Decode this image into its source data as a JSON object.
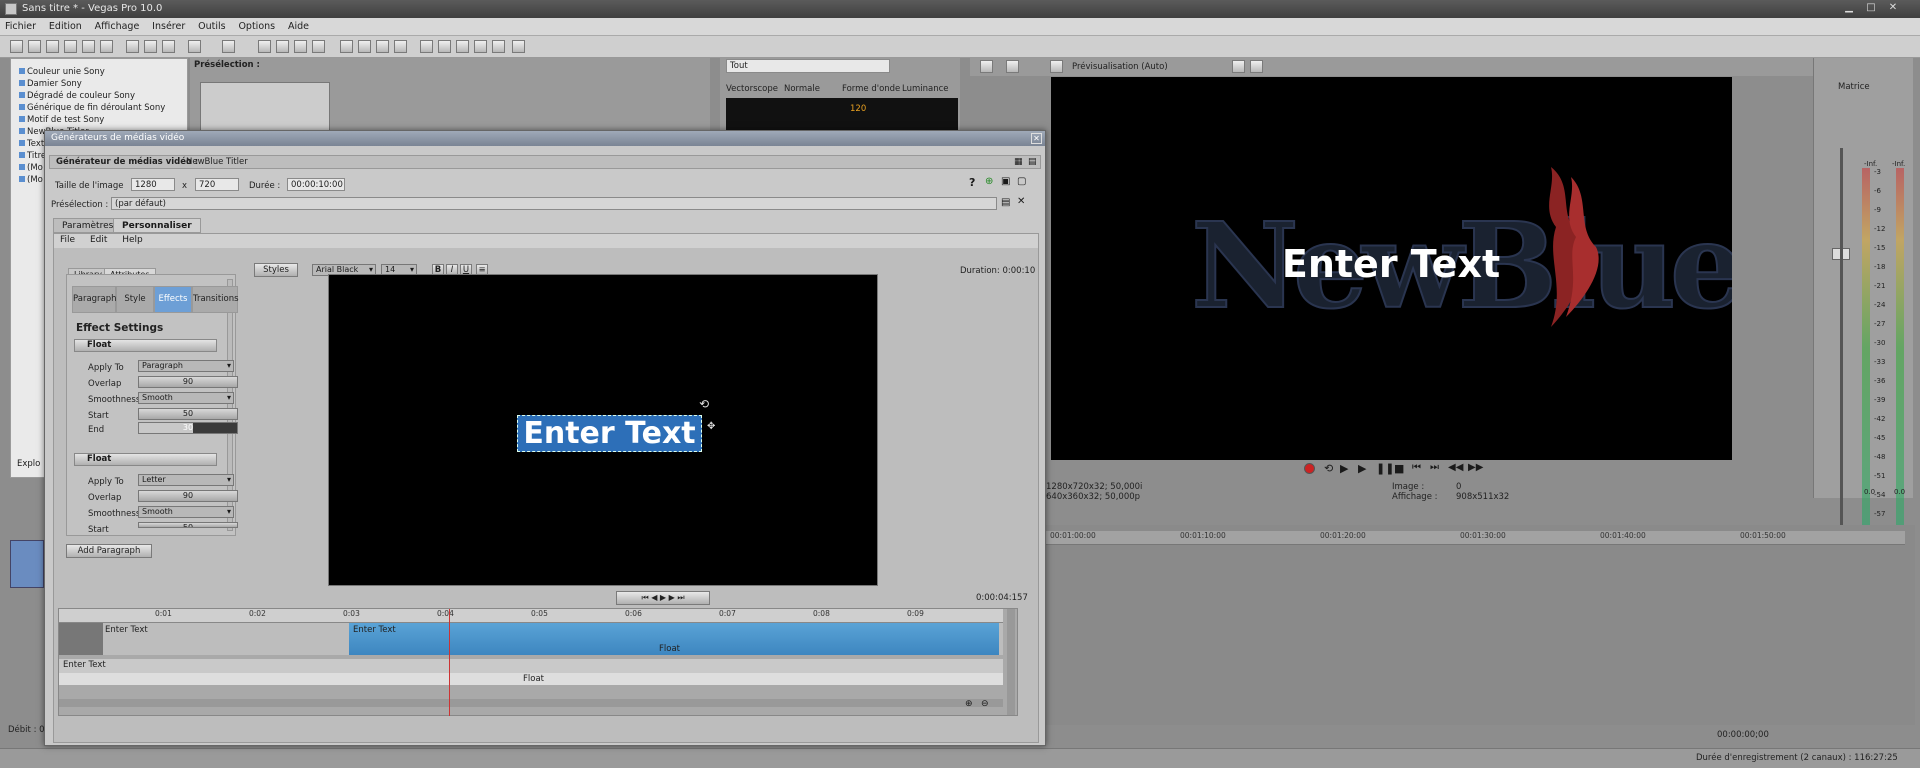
{
  "app": {
    "title": "Sans titre * - Vegas Pro 10.0"
  },
  "menu": [
    "Fichier",
    "Edition",
    "Affichage",
    "Insérer",
    "Outils",
    "Options",
    "Aide"
  ],
  "media_tree": [
    "Couleur unie Sony",
    "Damier Sony",
    "Dégradé de couleur Sony",
    "Générique de fin déroulant Sony",
    "Motif de test Sony",
    "NewBlue Titler",
    "Texte",
    "Titres",
    "(Mo",
    "(Mo"
  ],
  "preset_panel": {
    "label": "Présélection :"
  },
  "left_tab": "Explo",
  "scope": {
    "filter": "Tout",
    "vectorscope": "Vectorscope",
    "mode": "Normale",
    "waveform": "Forme d'onde",
    "luminance": "Luminance",
    "value": "120"
  },
  "preview": {
    "mode": "Prévisualisation (Auto)",
    "text": "Enter Text",
    "info_left_1": "1280x720x32; 50,000i",
    "info_left_2": "640x360x32; 50,000p",
    "image_label": "Image :",
    "image_val": "0",
    "display_label": "Affichage :",
    "display_val": "908x511x32"
  },
  "master": {
    "label": "Matrice",
    "levels": [
      "-3",
      "-6",
      "-9",
      "-12",
      "-15",
      "-18",
      "-21",
      "-24",
      "-27",
      "-30",
      "-33",
      "-36",
      "-39",
      "-42",
      "-45",
      "-48",
      "-51",
      "-54",
      "-57"
    ],
    "db_left": "0.0",
    "db_right": "0.0",
    "inf1": "-Inf.",
    "inf2": "-Inf."
  },
  "timeline": {
    "ticks": [
      "00:01:00:00",
      "00:01:10:00",
      "00:01:20:00",
      "00:01:30:00",
      "00:01:40:00",
      "00:01:50:00"
    ],
    "rec_time": "00:00:00;00",
    "duration": "Durée d'enregistrement (2 canaux) : 116:27:25",
    "debit": "Débit : 0"
  },
  "dialog": {
    "window_title": "Générateurs de médias vidéo",
    "generator_label": "Générateur de médias vidéo :",
    "generator_name": "NewBlue Titler",
    "size_label": "Taille de l'image",
    "width": "1280",
    "x": "x",
    "height": "720",
    "duration_label": "Durée :",
    "duration": "00:00:10:00",
    "preset_label": "Présélection :",
    "preset_value": "(par défaut)",
    "tabs": [
      "Paramètres",
      "Personnaliser"
    ],
    "titler": {
      "menu": [
        "File",
        "Edit",
        "Help"
      ],
      "side_tabs": [
        "Library",
        "Attributes"
      ],
      "effect_tabs": [
        "Paragraph",
        "Style",
        "Effects",
        "Transitions"
      ],
      "effect_settings": "Effect Settings",
      "float1": {
        "name": "Float",
        "apply_to_label": "Apply To",
        "apply_to": "Paragraph",
        "overlap_label": "Overlap",
        "overlap": "90",
        "smooth_label": "Smoothness",
        "smooth": "Smooth",
        "start_label": "Start",
        "start": "50",
        "end_label": "End",
        "end": "30"
      },
      "float2": {
        "name": "Float",
        "apply_to_label": "Apply To",
        "apply_to": "Letter",
        "overlap_label": "Overlap",
        "overlap": "90",
        "smooth_label": "Smoothness",
        "smooth": "Smooth",
        "start_label": "Start",
        "start": "50"
      },
      "styles_btn": "Styles",
      "font": "Arial Black",
      "font_size": "14",
      "bold": "B",
      "italic": "I",
      "underline": "U",
      "duration": "Duration: 0:00:10",
      "canvas_text": "Enter Text",
      "add_paragraph": "Add Paragraph",
      "time": "0:00:04:157",
      "ruler": [
        "0:01",
        "0:02",
        "0:03",
        "0:04",
        "0:05",
        "0:06",
        "0:07",
        "0:08",
        "0:09"
      ],
      "track1_label": "Enter Text",
      "track1_clip": "Enter Text",
      "track1_effect": "Float",
      "track2_label": "Enter Text",
      "track2_effect": "Float"
    }
  }
}
